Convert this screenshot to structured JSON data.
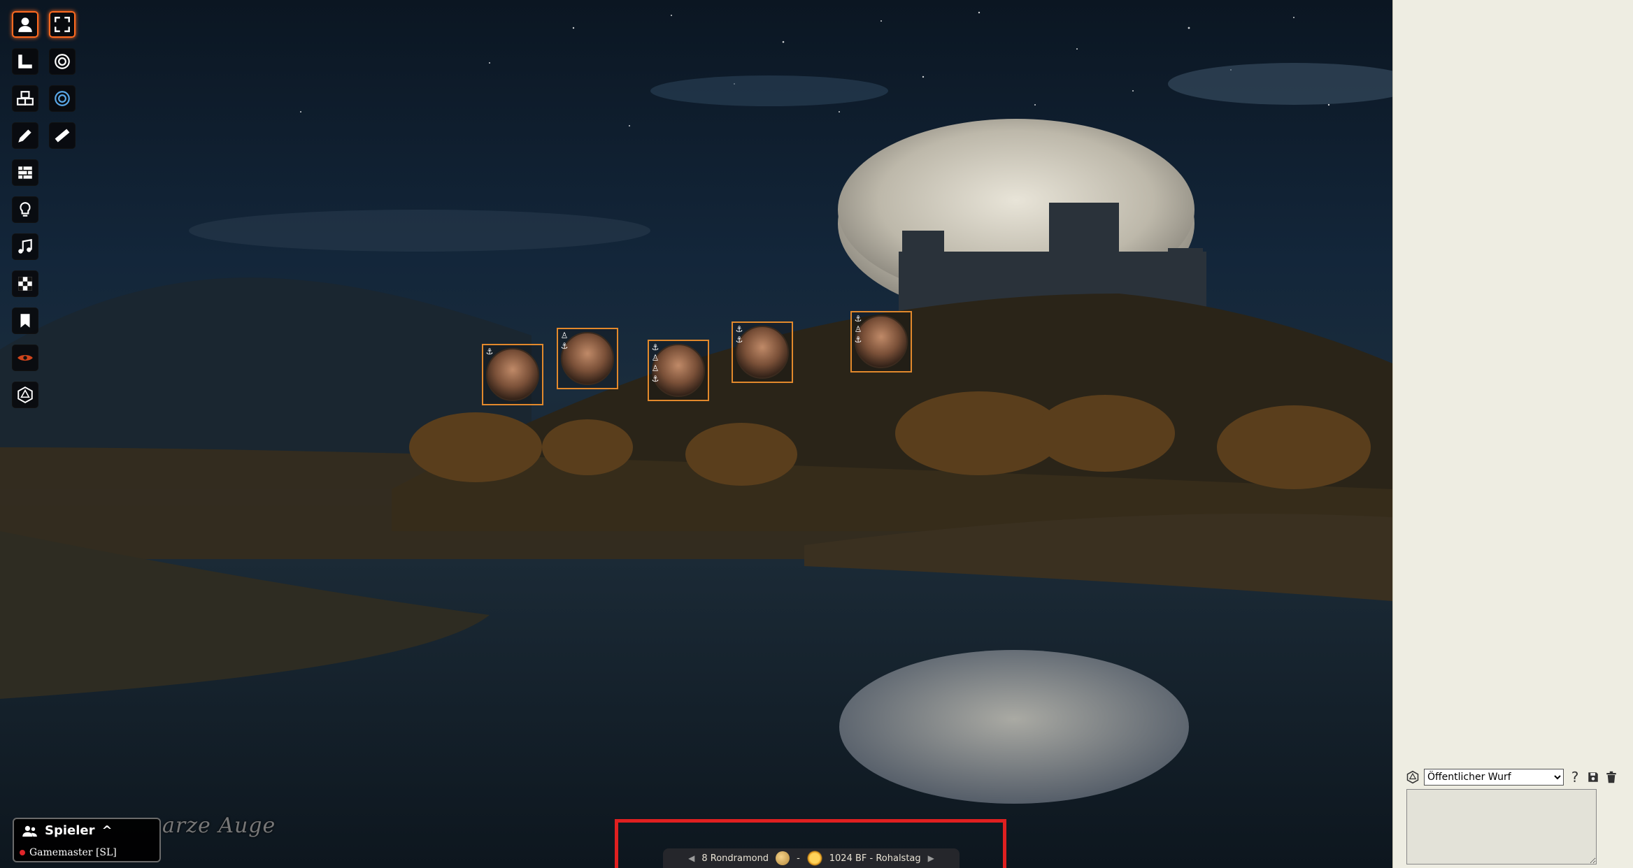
{
  "colors": {
    "accent": "#ff6a20",
    "token_border": "#e2892c",
    "highlight": "#e02020",
    "sidebar_bg": "#eeede2"
  },
  "left_controls": [
    {
      "name": "token-controls",
      "icon": "user-icon",
      "active": true
    },
    {
      "name": "measure-controls",
      "icon": "ruler-square-icon"
    },
    {
      "name": "tiles-controls",
      "icon": "cubes-icon"
    },
    {
      "name": "drawing-controls",
      "icon": "pencil-icon"
    },
    {
      "name": "walls-controls",
      "icon": "brick-wall-icon"
    },
    {
      "name": "lighting-controls",
      "icon": "lightbulb-icon"
    },
    {
      "name": "sound-controls",
      "icon": "music-icon"
    },
    {
      "name": "regions-controls",
      "icon": "checker-icon"
    },
    {
      "name": "notes-controls",
      "icon": "bookmark-icon"
    },
    {
      "name": "vision-controls",
      "icon": "eye-icon"
    },
    {
      "name": "dice-controls",
      "icon": "d20-icon"
    }
  ],
  "sub_controls": [
    {
      "name": "fullscreen-tool",
      "icon": "expand-icon",
      "active": true
    },
    {
      "name": "target-tool",
      "icon": "target-icon"
    },
    {
      "name": "target-blue-tool",
      "icon": "target-blue-icon"
    },
    {
      "name": "ruler-tool",
      "icon": "ruler-icon"
    }
  ],
  "tokens": [
    {
      "name": "token-bearded-dwarf",
      "status": [
        "⚓"
      ]
    },
    {
      "name": "token-young-man",
      "status": [
        "♙",
        "⚓"
      ]
    },
    {
      "name": "token-dark-hair-man",
      "status": [
        "⚓",
        "♙",
        "♙",
        "⚓"
      ]
    },
    {
      "name": "token-dark-hair-woman",
      "status": [
        "⚓",
        "⚓"
      ]
    },
    {
      "name": "token-blonde-woman",
      "status": [
        "⚓",
        "♙",
        "⚓"
      ]
    }
  ],
  "players": {
    "title": "Spieler",
    "caret": "^",
    "list": [
      {
        "name": "Gamemaster [SL]"
      }
    ]
  },
  "logo_text": "arze Auge",
  "calendar": {
    "prev": "◀",
    "date": "8 Rondramond",
    "separator": "-",
    "year": "1024 BF - Rohalstag",
    "next": "▶"
  },
  "chat": {
    "roll_mode": "Öffentlicher Wurf",
    "roll_options": [
      "Öffentlicher Wurf"
    ],
    "help": "?"
  }
}
